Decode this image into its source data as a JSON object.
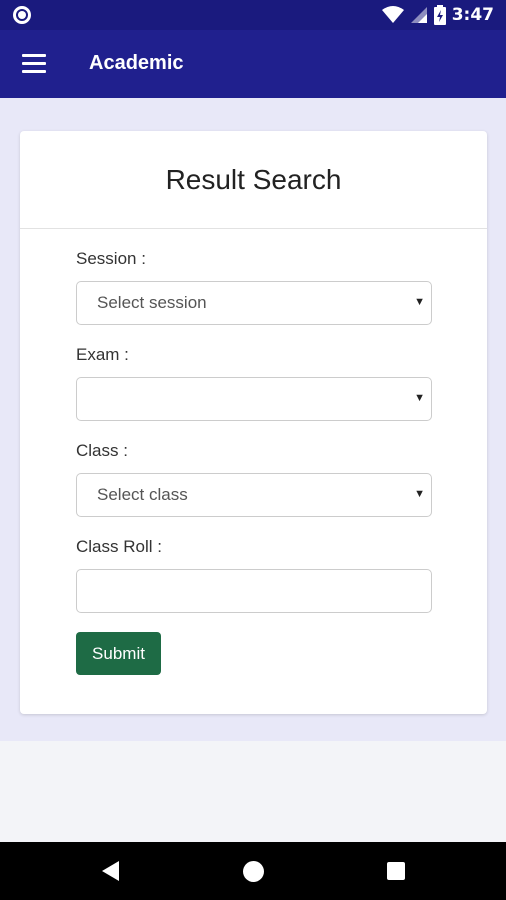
{
  "status_bar": {
    "time": "3:47"
  },
  "app_bar": {
    "title": "Academic"
  },
  "card": {
    "title": "Result Search"
  },
  "form": {
    "session_label": "Session :",
    "session_value": "Select session",
    "exam_label": "Exam :",
    "exam_value": "",
    "class_label": "Class :",
    "class_value": "Select class",
    "roll_label": "Class Roll :",
    "roll_value": "",
    "submit_label": "Submit",
    "caret_glyph": "▼"
  },
  "colors": {
    "status_bar": "#1a1a7e",
    "app_bar": "#20208e",
    "background": "#e8e8f8",
    "submit": "#1e6b45"
  },
  "icons": {
    "status_left": "circle-notification-icon",
    "wifi": "wifi-icon",
    "signal": "cell-signal-icon",
    "battery": "battery-icon",
    "menu": "hamburger-menu-icon",
    "back": "back-triangle-icon",
    "home": "home-circle-icon",
    "recent": "recent-apps-square-icon"
  }
}
